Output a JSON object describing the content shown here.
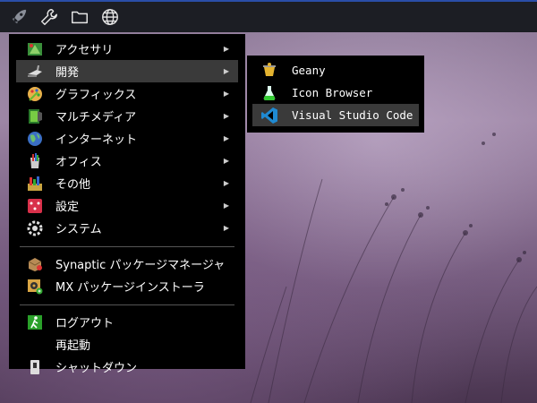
{
  "panel": {
    "buttons": [
      {
        "name": "menu-rocket-icon"
      },
      {
        "name": "wrench-icon"
      },
      {
        "name": "folder-icon"
      },
      {
        "name": "globe-icon"
      }
    ]
  },
  "main_menu": {
    "items": [
      {
        "label": "アクセサリ",
        "has_sub": true,
        "icon": "accessories-icon"
      },
      {
        "label": "開発",
        "has_sub": true,
        "icon": "development-icon",
        "active": true
      },
      {
        "label": "グラフィックス",
        "has_sub": true,
        "icon": "graphics-icon"
      },
      {
        "label": "マルチメディア",
        "has_sub": true,
        "icon": "multimedia-icon"
      },
      {
        "label": "インターネット",
        "has_sub": true,
        "icon": "internet-icon"
      },
      {
        "label": "オフィス",
        "has_sub": true,
        "icon": "office-icon"
      },
      {
        "label": "その他",
        "has_sub": true,
        "icon": "other-icon"
      },
      {
        "label": "設定",
        "has_sub": true,
        "icon": "settings-icon"
      },
      {
        "label": "システム",
        "has_sub": true,
        "icon": "system-icon"
      }
    ],
    "apps": [
      {
        "label": "Synaptic パッケージマネージャ",
        "icon": "synaptic-icon"
      },
      {
        "label": "MX パッケージインストーラ",
        "icon": "mx-installer-icon"
      }
    ],
    "session": [
      {
        "label": "ログアウト",
        "icon": "logout-icon"
      },
      {
        "label": "再起動",
        "icon": ""
      },
      {
        "label": "シャットダウン",
        "icon": "shutdown-icon"
      }
    ],
    "arrow": "▶"
  },
  "sub_menu": {
    "items": [
      {
        "label": "Geany",
        "icon": "geany-icon"
      },
      {
        "label": "Icon Browser",
        "icon": "icon-browser-icon"
      },
      {
        "label": "Visual Studio Code",
        "icon": "vscode-icon",
        "active": true
      }
    ]
  }
}
